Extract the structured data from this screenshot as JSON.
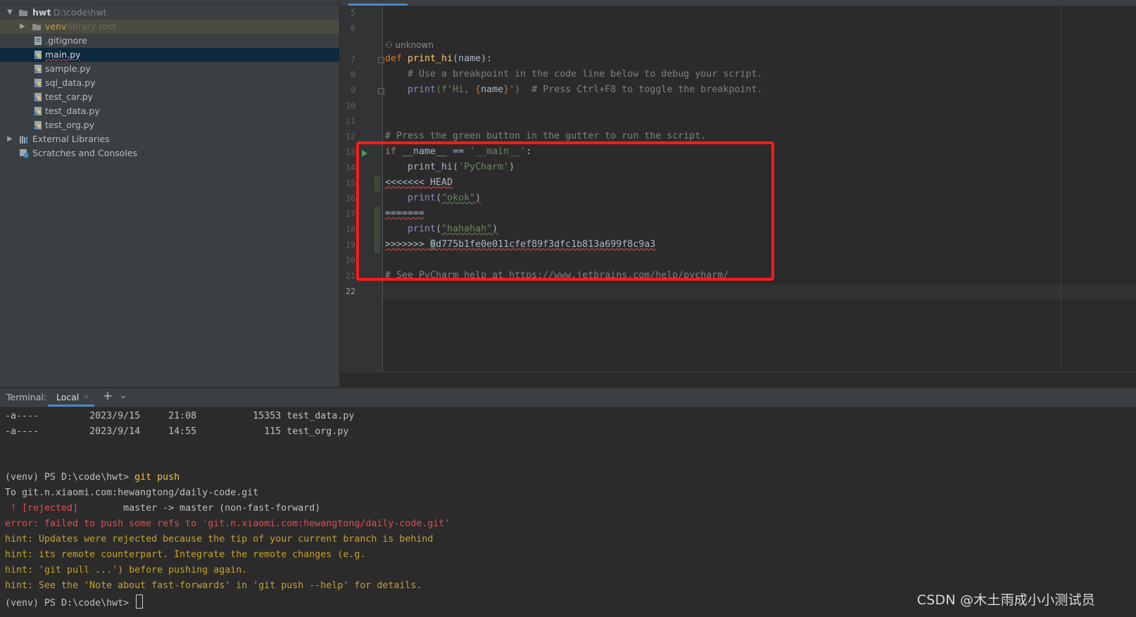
{
  "project": {
    "root_name": "hwt",
    "root_path": "D:\\code\\hwt",
    "items": [
      {
        "label": "venv",
        "suffix": "library root"
      },
      {
        "label": ".gitignore"
      },
      {
        "label": "main.py"
      },
      {
        "label": "sample.py"
      },
      {
        "label": "sql_data.py"
      },
      {
        "label": "test_car.py"
      },
      {
        "label": "test_data.py"
      },
      {
        "label": "test_org.py"
      },
      {
        "label": "External Libraries"
      },
      {
        "label": "Scratches and Consoles"
      }
    ]
  },
  "editor": {
    "author_hint": "unknown",
    "line_numbers": [
      "5",
      "6",
      "7",
      "8",
      "9",
      "10",
      "11",
      "12",
      "13",
      "14",
      "15",
      "16",
      "17",
      "18",
      "19",
      "20",
      "21",
      "22"
    ],
    "lines": {
      "l7_def": "def ",
      "l7_fn": "print_hi",
      "l7_rest": "(name):",
      "l8": "    # Use a breakpoint in the code line below to debug your script.",
      "l9_a": "    print",
      "l9_b": "(f'Hi, ",
      "l9_c": "{",
      "l9_d": "name",
      "l9_e": "}",
      "l9_f": "')",
      "l9_g": "  # Press Ctrl+F8 to toggle the breakpoint.",
      "l12": "# Press the green button in the gutter to run the script.",
      "l13_a": "if ",
      "l13_b": "__name__ == ",
      "l13_c": "'__main__'",
      "l13_d": ":",
      "l14_a": "    print_hi(",
      "l14_b": "'PyCharm'",
      "l14_c": ")",
      "l15_a": "<<<<<<< ",
      "l15_b": "HEAD",
      "l16_a": "    print",
      "l16_b": "(",
      "l16_c": "\"okok\"",
      "l16_d": ")",
      "l17": "=======",
      "l18_a": "    print",
      "l18_b": "(",
      "l18_c": "\"hahahah\"",
      "l18_d": ")",
      "l19_a": ">>>>>>> ",
      "l19_b": "0",
      "l19_c": "d775b1fe0e011cfef89f3dfc1b813a699f8c9a3",
      "l21": "# See PyCharm help at https://www.jetbrains.com/help/pycharm/"
    }
  },
  "terminal": {
    "title": "Terminal:",
    "tab_local": "Local",
    "close_glyph": "×",
    "add_glyph": "+",
    "menu_glyph": "⌄",
    "lines": [
      "-a----         2023/9/15     21:08          15353 test_data.py",
      "-a----         2023/9/14     14:55            115 test_org.py"
    ],
    "prompt": "(venv) PS D:\\code\\hwt> ",
    "command": "git push",
    "to_line": "To git.n.xiaomi.com:hewangtong/daily-code.git",
    "rejected_tag": " ! [rejected]",
    "rejected_rest": "        master -> master (non-fast-forward)",
    "error_line": "error: failed to push some refs to 'git.n.xiaomi.com:hewangtong/daily-code.git'",
    "hints": [
      "hint: Updates were rejected because the tip of your current branch is behind",
      "hint: its remote counterpart. Integrate the remote changes (e.g.",
      "hint: 'git pull ...') before pushing again.",
      "hint: See the 'Note about fast-forwards' in 'git push --help' for details."
    ],
    "final_prompt": "(venv) PS D:\\code\\hwt> "
  },
  "watermark": "CSDN @木土雨成小小测试员",
  "colors": {
    "accent": "#4a88c7",
    "highlight_box": "#ff1b1b",
    "error": "#e84a4a",
    "hint": "#c8a22a"
  }
}
